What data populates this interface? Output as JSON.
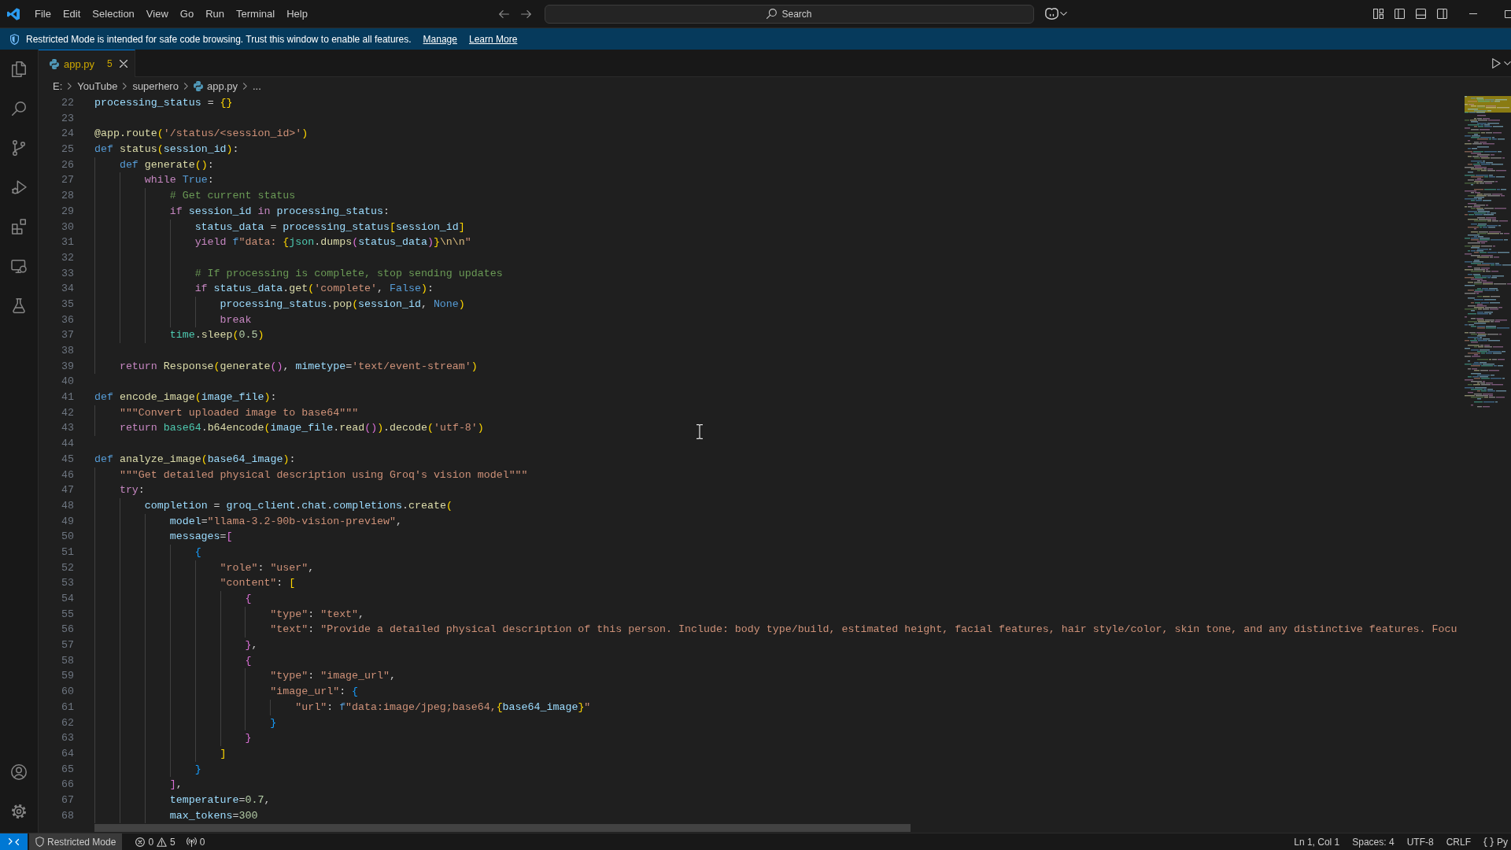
{
  "title_bar": {
    "menu": [
      "File",
      "Edit",
      "Selection",
      "View",
      "Go",
      "Run",
      "Terminal",
      "Help"
    ],
    "command_center": "Search"
  },
  "banner": {
    "message": "Restricted Mode is intended for safe code browsing. Trust this window to enable all features.",
    "links": [
      "Manage",
      "Learn More"
    ]
  },
  "tabs": [
    {
      "label": "app.py",
      "problems": "5",
      "selected": true
    }
  ],
  "breadcrumbs": [
    {
      "label": "E:",
      "kind": "folder"
    },
    {
      "label": "YouTube",
      "kind": "folder"
    },
    {
      "label": "superhero",
      "kind": "folder"
    },
    {
      "label": "app.py",
      "kind": "file"
    },
    {
      "label": "...",
      "kind": "symbol"
    }
  ],
  "editor": {
    "lines": [
      {
        "number": "22",
        "tokens": [
          {
            "kind": "variable",
            "text": "processing_status"
          },
          {
            "kind": "plain",
            "text": " = "
          },
          {
            "kind": "bracket1",
            "text": "{}"
          }
        ]
      },
      {
        "number": "23"
      },
      {
        "number": "24",
        "tokens": [
          {
            "kind": "function",
            "text": "@app.route"
          },
          {
            "kind": "bracket1",
            "text": "("
          },
          {
            "kind": "string",
            "text": "'/status/<session_id>'"
          },
          {
            "kind": "bracket1",
            "text": ")"
          }
        ]
      },
      {
        "number": "25",
        "tokens": [
          {
            "kind": "storage",
            "text": "def "
          },
          {
            "kind": "function",
            "text": "status"
          },
          {
            "kind": "bracket1",
            "text": "("
          },
          {
            "kind": "variable",
            "text": "session_id"
          },
          {
            "kind": "bracket1",
            "text": ")"
          },
          {
            "kind": "plain",
            "text": ":"
          }
        ]
      },
      {
        "number": "26",
        "tokens": [
          {
            "kind": "storage",
            "text": "    def "
          },
          {
            "kind": "function",
            "text": "generate"
          },
          {
            "kind": "bracket1",
            "text": "()"
          },
          {
            "kind": "plain",
            "text": ":"
          }
        ]
      },
      {
        "number": "27",
        "tokens": [
          {
            "kind": "control",
            "text": "        while "
          },
          {
            "kind": "storage",
            "text": "True"
          },
          {
            "kind": "plain",
            "text": ":"
          }
        ]
      },
      {
        "number": "28",
        "tokens": [
          {
            "kind": "comment",
            "text": "            # Get current status"
          }
        ]
      },
      {
        "number": "29",
        "tokens": [
          {
            "kind": "control",
            "text": "            if "
          },
          {
            "kind": "variable",
            "text": "session_id "
          },
          {
            "kind": "control",
            "text": "in "
          },
          {
            "kind": "variable",
            "text": "processing_status"
          },
          {
            "kind": "plain",
            "text": ":"
          }
        ]
      },
      {
        "number": "30",
        "tokens": [
          {
            "kind": "variable",
            "text": "                status_data"
          },
          {
            "kind": "plain",
            "text": " = "
          },
          {
            "kind": "variable",
            "text": "processing_status"
          },
          {
            "kind": "bracket1",
            "text": "["
          },
          {
            "kind": "variable",
            "text": "session_id"
          },
          {
            "kind": "bracket1",
            "text": "]"
          }
        ]
      },
      {
        "number": "31",
        "tokens": [
          {
            "kind": "control",
            "text": "                yield "
          },
          {
            "kind": "storage",
            "text": "f"
          },
          {
            "kind": "string",
            "text": "\"data: "
          },
          {
            "kind": "bracket1",
            "text": "{"
          },
          {
            "kind": "module",
            "text": "json"
          },
          {
            "kind": "plain",
            "text": "."
          },
          {
            "kind": "function",
            "text": "dumps"
          },
          {
            "kind": "bracket2",
            "text": "("
          },
          {
            "kind": "variable",
            "text": "status_data"
          },
          {
            "kind": "bracket2",
            "text": ")"
          },
          {
            "kind": "bracket1",
            "text": "}"
          },
          {
            "kind": "escape",
            "text": "\\n\\n"
          },
          {
            "kind": "string",
            "text": "\""
          }
        ]
      },
      {
        "number": "32"
      },
      {
        "number": "33",
        "tokens": [
          {
            "kind": "comment",
            "text": "                # If processing is complete, stop sending updates"
          }
        ]
      },
      {
        "number": "34",
        "tokens": [
          {
            "kind": "control",
            "text": "                if "
          },
          {
            "kind": "variable",
            "text": "status_data"
          },
          {
            "kind": "plain",
            "text": "."
          },
          {
            "kind": "function",
            "text": "get"
          },
          {
            "kind": "bracket1",
            "text": "("
          },
          {
            "kind": "string",
            "text": "'complete'"
          },
          {
            "kind": "plain",
            "text": ", "
          },
          {
            "kind": "storage",
            "text": "False"
          },
          {
            "kind": "bracket1",
            "text": ")"
          },
          {
            "kind": "plain",
            "text": ":"
          }
        ]
      },
      {
        "number": "35",
        "tokens": [
          {
            "kind": "variable",
            "text": "                    processing_status"
          },
          {
            "kind": "plain",
            "text": "."
          },
          {
            "kind": "function",
            "text": "pop"
          },
          {
            "kind": "bracket1",
            "text": "("
          },
          {
            "kind": "variable",
            "text": "session_id"
          },
          {
            "kind": "plain",
            "text": ", "
          },
          {
            "kind": "storage",
            "text": "None"
          },
          {
            "kind": "bracket1",
            "text": ")"
          }
        ]
      },
      {
        "number": "36",
        "tokens": [
          {
            "kind": "control",
            "text": "                    break"
          }
        ]
      },
      {
        "number": "37",
        "tokens": [
          {
            "kind": "module",
            "text": "            time"
          },
          {
            "kind": "plain",
            "text": "."
          },
          {
            "kind": "function",
            "text": "sleep"
          },
          {
            "kind": "bracket1",
            "text": "("
          },
          {
            "kind": "number",
            "text": "0.5"
          },
          {
            "kind": "bracket1",
            "text": ")"
          }
        ]
      },
      {
        "number": "38"
      },
      {
        "number": "39",
        "tokens": [
          {
            "kind": "control",
            "text": "    return "
          },
          {
            "kind": "function",
            "text": "Response"
          },
          {
            "kind": "bracket1",
            "text": "("
          },
          {
            "kind": "function",
            "text": "generate"
          },
          {
            "kind": "bracket2",
            "text": "()"
          },
          {
            "kind": "plain",
            "text": ", "
          },
          {
            "kind": "variable",
            "text": "mimetype"
          },
          {
            "kind": "plain",
            "text": "="
          },
          {
            "kind": "string",
            "text": "'text/event-stream'"
          },
          {
            "kind": "bracket1",
            "text": ")"
          }
        ]
      },
      {
        "number": "40"
      },
      {
        "number": "41",
        "tokens": [
          {
            "kind": "storage",
            "text": "def "
          },
          {
            "kind": "function",
            "text": "encode_image"
          },
          {
            "kind": "bracket1",
            "text": "("
          },
          {
            "kind": "variable",
            "text": "image_file"
          },
          {
            "kind": "bracket1",
            "text": ")"
          },
          {
            "kind": "plain",
            "text": ":"
          }
        ]
      },
      {
        "number": "42",
        "tokens": [
          {
            "kind": "string",
            "text": "    \"\"\"Convert uploaded image to base64\"\"\""
          }
        ]
      },
      {
        "number": "43",
        "tokens": [
          {
            "kind": "control",
            "text": "    return "
          },
          {
            "kind": "module",
            "text": "base64"
          },
          {
            "kind": "plain",
            "text": "."
          },
          {
            "kind": "function",
            "text": "b64encode"
          },
          {
            "kind": "bracket1",
            "text": "("
          },
          {
            "kind": "variable",
            "text": "image_file"
          },
          {
            "kind": "plain",
            "text": "."
          },
          {
            "kind": "function",
            "text": "read"
          },
          {
            "kind": "bracket2",
            "text": "()"
          },
          {
            "kind": "bracket1",
            "text": ")"
          },
          {
            "kind": "plain",
            "text": "."
          },
          {
            "kind": "function",
            "text": "decode"
          },
          {
            "kind": "bracket1",
            "text": "("
          },
          {
            "kind": "string",
            "text": "'utf-8'"
          },
          {
            "kind": "bracket1",
            "text": ")"
          }
        ]
      },
      {
        "number": "44"
      },
      {
        "number": "45",
        "tokens": [
          {
            "kind": "storage",
            "text": "def "
          },
          {
            "kind": "function",
            "text": "analyze_image"
          },
          {
            "kind": "bracket1",
            "text": "("
          },
          {
            "kind": "variable",
            "text": "base64_image"
          },
          {
            "kind": "bracket1",
            "text": ")"
          },
          {
            "kind": "plain",
            "text": ":"
          }
        ]
      },
      {
        "number": "46",
        "tokens": [
          {
            "kind": "string",
            "text": "    \"\"\"Get detailed physical description using Groq's vision model\"\"\""
          }
        ]
      },
      {
        "number": "47",
        "tokens": [
          {
            "kind": "control",
            "text": "    try"
          },
          {
            "kind": "plain",
            "text": ":"
          }
        ]
      },
      {
        "number": "48",
        "tokens": [
          {
            "kind": "variable",
            "text": "        completion"
          },
          {
            "kind": "plain",
            "text": " = "
          },
          {
            "kind": "variable",
            "text": "groq_client"
          },
          {
            "kind": "plain",
            "text": "."
          },
          {
            "kind": "variable",
            "text": "chat"
          },
          {
            "kind": "plain",
            "text": "."
          },
          {
            "kind": "variable",
            "text": "completions"
          },
          {
            "kind": "plain",
            "text": "."
          },
          {
            "kind": "function",
            "text": "create"
          },
          {
            "kind": "bracket1",
            "text": "("
          }
        ]
      },
      {
        "number": "49",
        "tokens": [
          {
            "kind": "variable",
            "text": "            model"
          },
          {
            "kind": "plain",
            "text": "="
          },
          {
            "kind": "string",
            "text": "\"llama-3.2-90b-vision-preview\""
          },
          {
            "kind": "plain",
            "text": ","
          }
        ]
      },
      {
        "number": "50",
        "tokens": [
          {
            "kind": "variable",
            "text": "            messages"
          },
          {
            "kind": "plain",
            "text": "="
          },
          {
            "kind": "bracket2",
            "text": "["
          }
        ]
      },
      {
        "number": "51",
        "tokens": [
          {
            "kind": "bracket3",
            "text": "                {"
          }
        ]
      },
      {
        "number": "52",
        "tokens": [
          {
            "kind": "string",
            "text": "                    \"role\""
          },
          {
            "kind": "plain",
            "text": ": "
          },
          {
            "kind": "string",
            "text": "\"user\""
          },
          {
            "kind": "plain",
            "text": ","
          }
        ]
      },
      {
        "number": "53",
        "tokens": [
          {
            "kind": "string",
            "text": "                    \"content\""
          },
          {
            "kind": "plain",
            "text": ": "
          },
          {
            "kind": "bracket1",
            "text": "["
          }
        ]
      },
      {
        "number": "54",
        "tokens": [
          {
            "kind": "bracket2",
            "text": "                        {"
          }
        ]
      },
      {
        "number": "55",
        "tokens": [
          {
            "kind": "string",
            "text": "                            \"type\""
          },
          {
            "kind": "plain",
            "text": ": "
          },
          {
            "kind": "string",
            "text": "\"text\""
          },
          {
            "kind": "plain",
            "text": ","
          }
        ]
      },
      {
        "number": "56",
        "tokens": [
          {
            "kind": "string",
            "text": "                            \"text\""
          },
          {
            "kind": "plain",
            "text": ": "
          },
          {
            "kind": "string",
            "text": "\"Provide a detailed physical description of this person. Include: body type/build, estimated height, facial features, hair style/color, skin tone, and any distinctive features. Focu"
          }
        ]
      },
      {
        "number": "57",
        "tokens": [
          {
            "kind": "bracket2",
            "text": "                        }"
          },
          {
            "kind": "plain",
            "text": ","
          }
        ]
      },
      {
        "number": "58",
        "tokens": [
          {
            "kind": "bracket2",
            "text": "                        {"
          }
        ]
      },
      {
        "number": "59",
        "tokens": [
          {
            "kind": "string",
            "text": "                            \"type\""
          },
          {
            "kind": "plain",
            "text": ": "
          },
          {
            "kind": "string",
            "text": "\"image_url\""
          },
          {
            "kind": "plain",
            "text": ","
          }
        ]
      },
      {
        "number": "60",
        "tokens": [
          {
            "kind": "string",
            "text": "                            \"image_url\""
          },
          {
            "kind": "plain",
            "text": ": "
          },
          {
            "kind": "bracket3",
            "text": "{"
          }
        ]
      },
      {
        "number": "61",
        "tokens": [
          {
            "kind": "string",
            "text": "                                \"url\""
          },
          {
            "kind": "plain",
            "text": ": "
          },
          {
            "kind": "storage",
            "text": "f"
          },
          {
            "kind": "string",
            "text": "\"data:image/jpeg;base64,"
          },
          {
            "kind": "bracket1",
            "text": "{"
          },
          {
            "kind": "variable",
            "text": "base64_image"
          },
          {
            "kind": "bracket1",
            "text": "}"
          },
          {
            "kind": "string",
            "text": "\""
          }
        ]
      },
      {
        "number": "62",
        "tokens": [
          {
            "kind": "bracket3",
            "text": "                            }"
          }
        ]
      },
      {
        "number": "63",
        "tokens": [
          {
            "kind": "bracket2",
            "text": "                        }"
          }
        ]
      },
      {
        "number": "64",
        "tokens": [
          {
            "kind": "bracket1",
            "text": "                    ]"
          }
        ]
      },
      {
        "number": "65",
        "tokens": [
          {
            "kind": "bracket3",
            "text": "                }"
          }
        ]
      },
      {
        "number": "66",
        "tokens": [
          {
            "kind": "bracket2",
            "text": "            ]"
          },
          {
            "kind": "plain",
            "text": ","
          }
        ]
      },
      {
        "number": "67",
        "tokens": [
          {
            "kind": "variable",
            "text": "            temperature"
          },
          {
            "kind": "plain",
            "text": "="
          },
          {
            "kind": "number",
            "text": "0.7"
          },
          {
            "kind": "plain",
            "text": ","
          }
        ]
      },
      {
        "number": "68",
        "tokens": [
          {
            "kind": "variable",
            "text": "            max_tokens"
          },
          {
            "kind": "plain",
            "text": "="
          },
          {
            "kind": "number",
            "text": "300"
          }
        ]
      }
    ]
  },
  "status_bar": {
    "restricted_mode": "Restricted Mode",
    "errors": "0",
    "warnings": "5",
    "ports": "0",
    "cursor_position": "Ln 1, Col 1",
    "indentation": "Spaces: 4",
    "encoding": "UTF-8",
    "line_ending": "CRLF",
    "language": "Py"
  }
}
